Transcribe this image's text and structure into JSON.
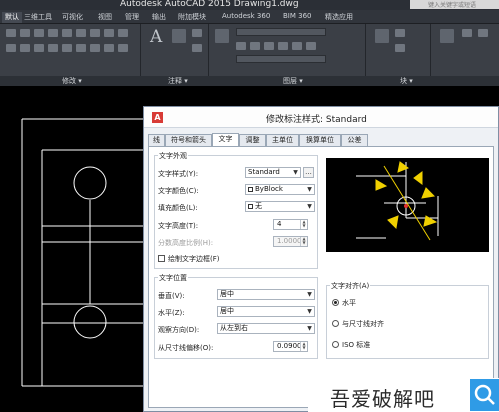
{
  "app": {
    "title": "Autodesk AutoCAD 2015    Drawing1.dwg",
    "search_placeholder": "键入关键字或短语"
  },
  "ribbon_tabs": [
    {
      "label": "默认"
    },
    {
      "label": "三维工具"
    },
    {
      "label": "可视化"
    },
    {
      "label": "视图"
    },
    {
      "label": "管理"
    },
    {
      "label": "输出"
    },
    {
      "label": "附加模块"
    },
    {
      "label": "Autodesk 360"
    },
    {
      "label": "BIM 360"
    },
    {
      "label": "精选应用"
    }
  ],
  "ribbon_panels": {
    "modify": "修改 ▾",
    "annotation": "注释 ▾",
    "layers": "图层 ▾",
    "block": "块 ▾"
  },
  "dialog": {
    "title": "修改标注样式: Standard",
    "title_icon": "A",
    "tabs": [
      "线",
      "符号和箭头",
      "文字",
      "调整",
      "主单位",
      "换算单位",
      "公差"
    ],
    "active_tab": "文字",
    "text_appearance": {
      "group_label": "文字外观",
      "style_label": "文字样式(Y):",
      "style_value": "Standard",
      "color_label": "文字颜色(C):",
      "color_value": "ByBlock",
      "fill_label": "填充颜色(L):",
      "fill_value": "无",
      "height_label": "文字高度(T):",
      "height_value": "4",
      "fraction_label": "分数高度比例(H):",
      "fraction_value": "1.0000",
      "frame_label": "绘制文字边框(F)",
      "ellipsis": "..."
    },
    "text_placement": {
      "group_label": "文字位置",
      "vertical_label": "垂直(V):",
      "vertical_value": "居中",
      "horizontal_label": "水平(Z):",
      "horizontal_value": "居中",
      "view_dir_label": "观察方向(D):",
      "view_dir_value": "从左到右",
      "offset_label": "从尺寸线偏移(O):",
      "offset_value": "0.0900"
    },
    "text_alignment": {
      "group_label": "文字对齐(A)",
      "options": [
        "水平",
        "与尺寸线对齐",
        "ISO 标准"
      ],
      "selected": "水平"
    }
  },
  "watermark": {
    "text": "吾爱破解吧",
    "icon": "search-icon"
  }
}
